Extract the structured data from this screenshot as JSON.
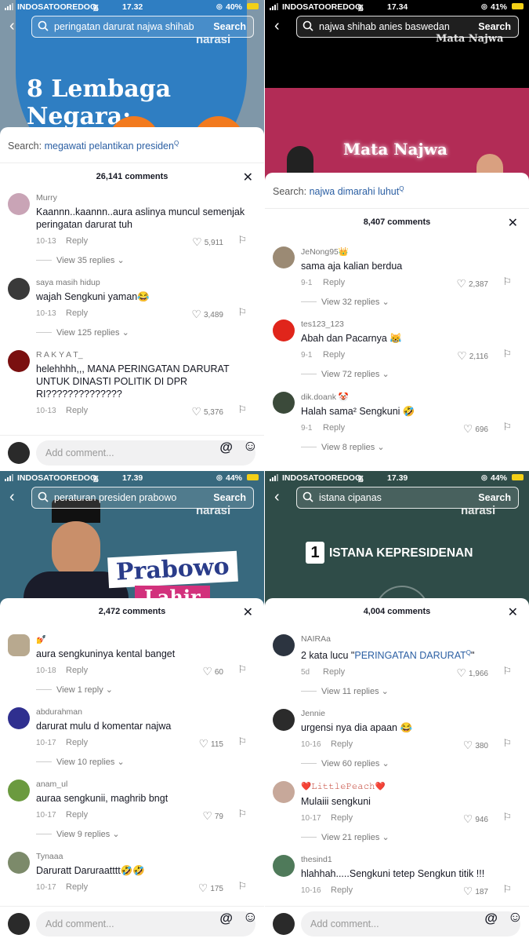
{
  "panels": [
    {
      "status": {
        "carrier": "INDOSATOOREDOO",
        "time": "17.32",
        "battery": "40%"
      },
      "search": {
        "query": "peringatan darurat najwa shihab",
        "button": "Search"
      },
      "watermark": "narasi",
      "video_title": "8 Lembaga Negara:",
      "related": {
        "label": "Search:",
        "term": "megawati pelantikan presiden"
      },
      "comment_count": "26,141 comments",
      "comments": [
        {
          "user": "Murry",
          "text": "Kaannn..kaannn..aura aslinya muncul semenjak peringatan darurat tuh",
          "date": "10-13",
          "reply": "Reply",
          "likes": "5,911",
          "view": "View 35 replies"
        },
        {
          "user": "saya masih hidup",
          "text": "wajah Sengkuni yaman😂",
          "date": "10-13",
          "reply": "Reply",
          "likes": "3,489",
          "view": "View 125 replies"
        },
        {
          "user": "R A K Y A T_",
          "text": "helehhhh,,, MANA PERINGATAN DARURAT UNTUK DINASTI POLITIK DI DPR RI??????????????",
          "date": "10-13",
          "reply": "Reply",
          "likes": "5,376",
          "view": ""
        }
      ],
      "add_comment": "Add comment..."
    },
    {
      "status": {
        "carrier": "INDOSATOOREDOO",
        "time": "17.34",
        "battery": "41%"
      },
      "search": {
        "query": "najwa shihab anies baswedan",
        "button": "Search"
      },
      "watermark": "Mata Najwa",
      "video_title": "Mata Najwa",
      "related": {
        "label": "Search:",
        "term": "najwa dimarahi luhut"
      },
      "comment_count": "8,407 comments",
      "comments": [
        {
          "user": "JeNong95👑",
          "text": "sama aja kalian berdua",
          "date": "9-1",
          "reply": "Reply",
          "likes": "2,387",
          "view": "View 32 replies"
        },
        {
          "user": "tes123_123",
          "text": "Abah dan Pacarnya 😹",
          "date": "9-1",
          "reply": "Reply",
          "likes": "2,116",
          "view": "View 72 replies"
        },
        {
          "user": "dik.doank 🤡",
          "text": "Halah sama² Sengkuni 🤣",
          "date": "9-1",
          "reply": "Reply",
          "likes": "696",
          "view": "View 8 replies"
        }
      ],
      "add_comment": ""
    },
    {
      "status": {
        "carrier": "INDOSATOOREDOO",
        "time": "17.39",
        "battery": "44%"
      },
      "search": {
        "query": "peraturan presiden prabowo",
        "button": "Search"
      },
      "watermark": "narasi",
      "video_title": "Prabowo",
      "video_subtitle": "Lahir",
      "related": null,
      "comment_count": "2,472 comments",
      "comments": [
        {
          "user": "💅",
          "text": "aura sengkuninya kental banget",
          "date": "10-18",
          "reply": "Reply",
          "likes": "60",
          "view": "View 1 reply"
        },
        {
          "user": "abdurahman",
          "text": "darurat mulu d komentar najwa",
          "date": "10-17",
          "reply": "Reply",
          "likes": "115",
          "view": "View 10 replies"
        },
        {
          "user": "anam_ul",
          "text": "auraa sengkunii, maghrib bngt",
          "date": "10-17",
          "reply": "Reply",
          "likes": "79",
          "view": "View 9 replies"
        },
        {
          "user": "Tynaaa",
          "text": "Daruratt Daruraatttt🤣🤣",
          "date": "10-17",
          "reply": "Reply",
          "likes": "175",
          "view": ""
        }
      ],
      "add_comment": "Add comment..."
    },
    {
      "status": {
        "carrier": "INDOSATOOREDOO",
        "time": "17.39",
        "battery": "44%"
      },
      "search": {
        "query": "istana cipanas",
        "button": "Search"
      },
      "watermark": "narasi",
      "video_badge": "1",
      "video_title": "ISTANA KEPRESIDENAN",
      "related": null,
      "comment_count": "4,004 comments",
      "comments": [
        {
          "user": "NAIRAa",
          "text_prefix": "2 kata lucu \"",
          "text_link": "PERINGATAN DARURAT",
          "text_suffix": "\"",
          "date": "5d",
          "reply": "Reply",
          "likes": "1,966",
          "view": "View 11 replies"
        },
        {
          "user": "Jennie",
          "text": "urgensi nya dia apaan 😂",
          "date": "10-16",
          "reply": "Reply",
          "likes": "380",
          "view": "View 60 replies"
        },
        {
          "user": "❤️𝙻𝚒𝚝𝚝𝚕𝚎𝙿𝚎𝚊𝚌𝚑❤️",
          "text": "Mulaiii sengkuni",
          "date": "10-17",
          "reply": "Reply",
          "likes": "946",
          "view": "View 21 replies"
        },
        {
          "user": "thesind1",
          "text": "hlahhah.....Sengkuni tetep Sengkun titik !!!",
          "date": "10-16",
          "reply": "Reply",
          "likes": "187",
          "view": ""
        }
      ],
      "add_comment": "Add comment..."
    }
  ],
  "colors": {
    "link": "#2b5fa3",
    "battery": "#f3d017"
  },
  "icons": [
    "back-icon",
    "search-icon",
    "close-icon",
    "heart-icon",
    "dislike-icon",
    "at-icon",
    "emoji-icon",
    "wifi-icon",
    "alarm-icon",
    "battery-icon"
  ]
}
